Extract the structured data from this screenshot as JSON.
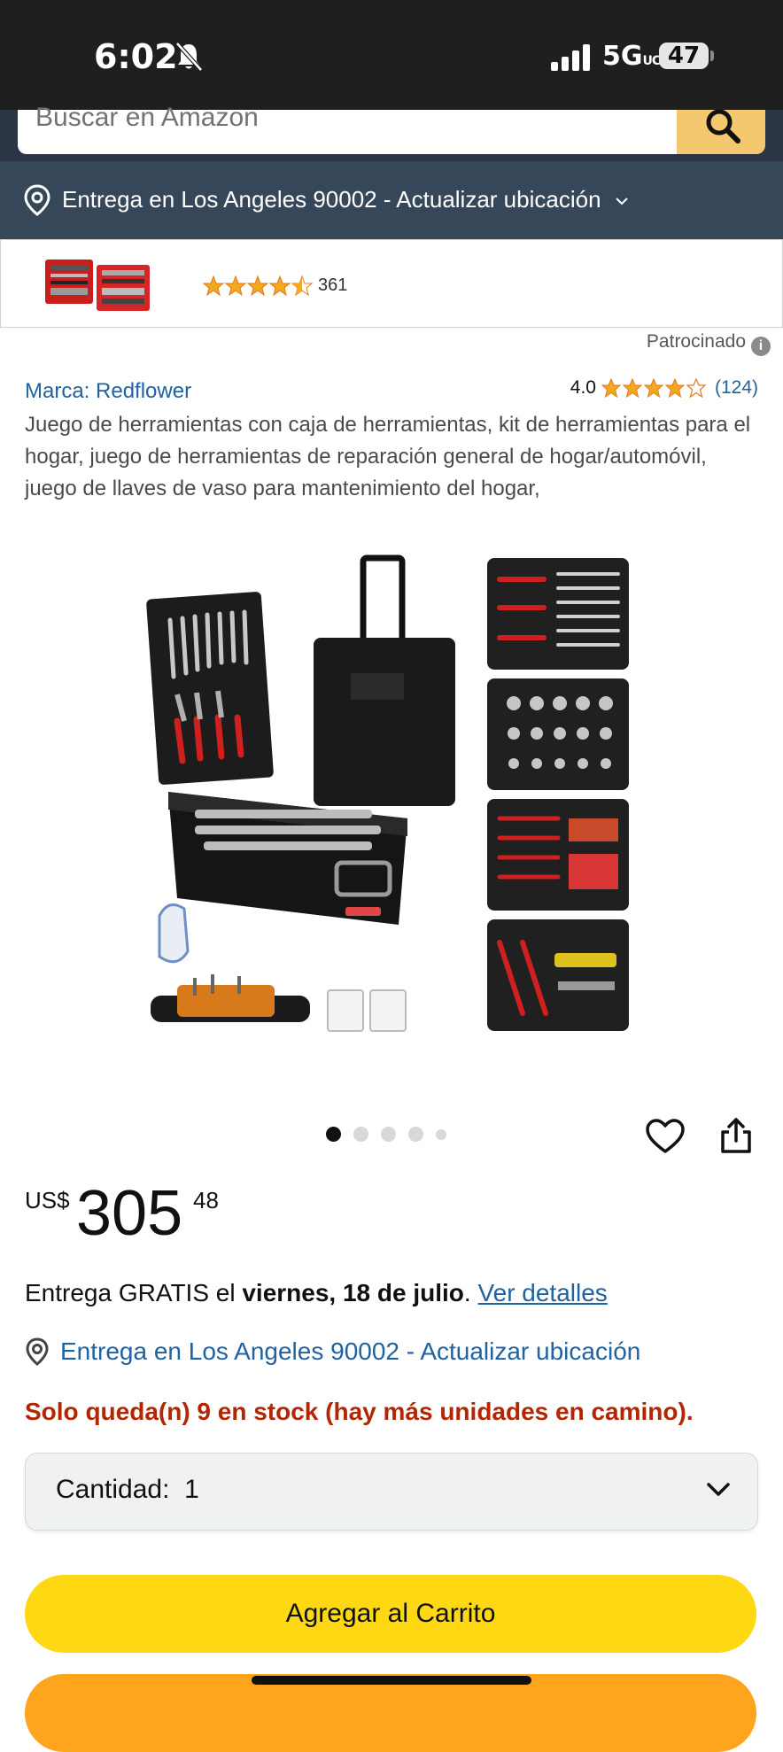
{
  "status_bar": {
    "time": "6:02",
    "network": "5G",
    "network_suffix": "UC",
    "battery": "47"
  },
  "search": {
    "placeholder": "Buscar en Amazon"
  },
  "location_bar": {
    "text": "Entrega en Los Angeles 90002 - Actualizar ubicación"
  },
  "sponsored_banner": {
    "review_count": "361",
    "rating": 4.5
  },
  "sponsored_label": "Patrocinado",
  "product": {
    "brand": "Marca: Redflower",
    "rating_value": "4.0",
    "rating_count": "(124)",
    "title": "Juego de herramientas con caja de herramientas, kit de herramientas para el hogar, juego de herramientas de reparación general de hogar/automóvil, juego de llaves de vaso para mantenimiento del hogar,",
    "image_pages": 5,
    "active_image": 1
  },
  "price": {
    "currency": "US$",
    "whole": "305",
    "fraction": "48"
  },
  "delivery": {
    "prefix": "Entrega GRATIS el ",
    "date": "viernes, 18 de julio",
    "suffix": ". ",
    "link": "Ver detalles"
  },
  "delivery_location": "Entrega en Los Angeles 90002 - Actualizar ubicación",
  "stock": "Solo queda(n) 9 en stock (hay más unidades en camino).",
  "quantity": {
    "label": "Cantidad:",
    "value": "1"
  },
  "buttons": {
    "add_to_cart": "Agregar al Carrito"
  },
  "colors": {
    "accent_yellow": "#FFD814",
    "buy_orange": "#FFA41C",
    "link_blue": "#2162A1",
    "stock_red": "#B12704",
    "nav_dark": "#37475A"
  }
}
